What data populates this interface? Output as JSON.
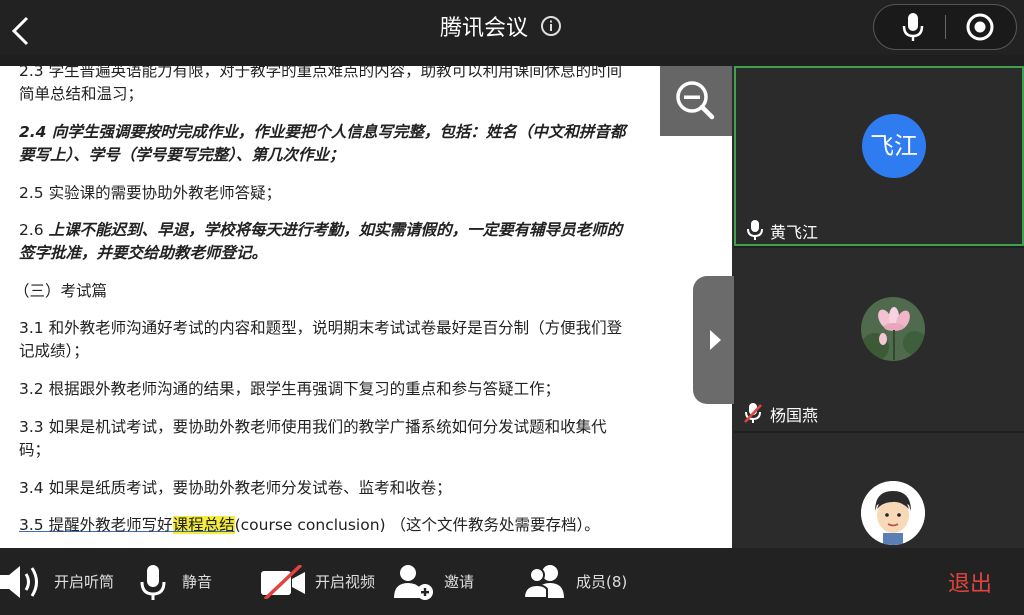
{
  "header": {
    "title": "腾讯会议"
  },
  "document": {
    "lines": [
      "2.3 学生普遍英语能力有限，对于教学的重点难点的内容，助教可以利用课间休息的时间",
      "简单总结和温习；",
      "2.4 向学生强调要按时完成作业，作业要把个人信息写完整，包括：姓名（中文和拼音都",
      "要写上）、学号（学号要写完整）、第几次作业；",
      "2.5 实验课的需要协助外教老师答疑；",
      "2.6 上课不能迟到、早退，学校将每天进行考勤，如实需请假的，一定要有辅导员老师的",
      "签字批准，并要交给助教老师登记。",
      "（三）考试篇",
      "3.1 和外教老师沟通好考试的内容和题型，说明期末考试试卷最好是百分制（方便我们登",
      "记成绩）；",
      "3.2 根据跟外教老师沟通的结果，跟学生再强调下复习的重点和参与答疑工作；",
      "3.3 如果是机试考试，要协助外教老师使用我们的教学广播系统如何分发试题和收集代",
      "码；",
      "3.4 如果是纸质考试，要协助外教老师分发试卷、监考和收卷；"
    ],
    "line_2_6_prefix": "2.6 ",
    "line_2_6_rest": "上课不能迟到、早退，学校将每天进行考勤，如实需请假的，一定要有辅导员老师的",
    "last_line": {
      "part1": "3.5 提醒外教老师写好",
      "highlight": "课程总结",
      "part2": "(course conclusion) （这个文件教务处需要存档）。"
    }
  },
  "participants": [
    {
      "name": "黄飞江",
      "avatar_text": "飞江",
      "avatar_color": "#2f7bf0",
      "muted": false
    },
    {
      "name": "杨国燕",
      "avatar_text": "",
      "muted": true
    },
    {
      "name": "",
      "avatar_text": "",
      "muted": false
    }
  ],
  "toolbar": {
    "speaker": "开启听筒",
    "mute": "静音",
    "video": "开启视频",
    "invite": "邀请",
    "members": "成员(8)",
    "exit": "退出"
  },
  "colors": {
    "accent_green": "#3fa14d",
    "exit_red": "#e0443e",
    "highlight": "#f6ec3c"
  }
}
